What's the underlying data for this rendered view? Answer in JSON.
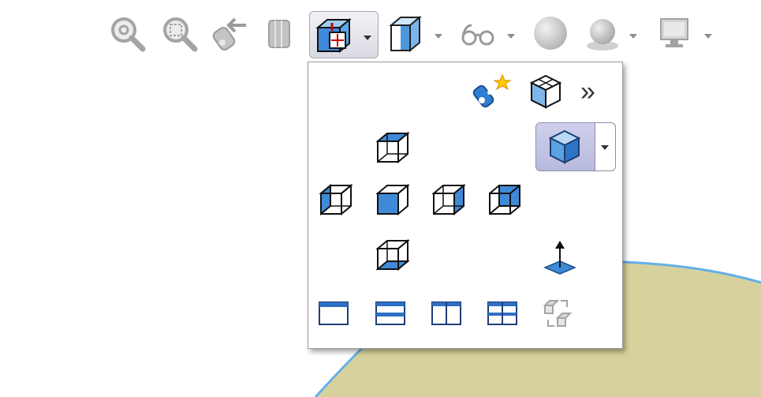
{
  "colors": {
    "canvas_bg": "#ffffff",
    "surface_fill": "#d7d29d",
    "surface_edge": "#63b0e6",
    "menu_border": "#9c9c9c",
    "selected_bg": "#c4c5e6",
    "icon_blue": "#2f7fd0",
    "icon_gray": "#a9a9a9"
  },
  "toolbar": {
    "items": [
      {
        "name": "zoom-to-fit",
        "icon": "magnifier-icon",
        "enabled": false
      },
      {
        "name": "zoom-to-area",
        "icon": "zoom-area-icon",
        "enabled": false
      },
      {
        "name": "previous-view",
        "icon": "previous-view-icon",
        "enabled": false
      },
      {
        "name": "section-view",
        "icon": "section-view-icon",
        "enabled": false
      },
      {
        "name": "view-orientation",
        "icon": "view-orientation-icon",
        "enabled": true,
        "active": true,
        "has_dropdown": true
      },
      {
        "name": "display-style",
        "icon": "display-style-icon",
        "enabled": true,
        "has_dropdown": true
      },
      {
        "name": "hide-show-items",
        "icon": "glasses-icon",
        "enabled": false,
        "has_dropdown": true
      },
      {
        "name": "edit-appearance",
        "icon": "sphere-icon",
        "enabled": false
      },
      {
        "name": "apply-scene",
        "icon": "scene-icon",
        "enabled": false,
        "has_dropdown": true
      },
      {
        "name": "view-settings",
        "icon": "monitor-icon",
        "enabled": false,
        "has_dropdown": true
      }
    ]
  },
  "flyout": {
    "top_row": [
      "new-view-icon",
      "view-selector-cube-icon",
      "more-icon"
    ],
    "top_row_more_glyph": "»",
    "standard_views": [
      "top-view-icon",
      "isometric-view-icon",
      "left-view-icon",
      "front-view-icon",
      "right-view-icon",
      "back-view-icon",
      "bottom-view-icon",
      "normal-to-icon"
    ],
    "selected_view": "isometric-view-icon",
    "viewport_layouts": [
      "single-view-icon",
      "two-view-horizontal-icon",
      "two-view-vertical-icon",
      "four-view-icon",
      "link-views-icon"
    ],
    "link_views_enabled": false
  }
}
